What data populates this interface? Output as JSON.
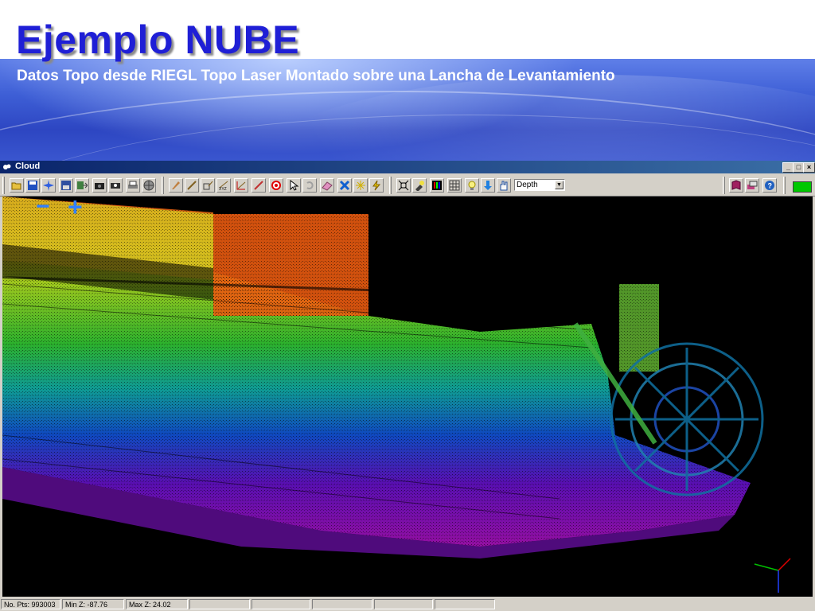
{
  "slide": {
    "title": "Ejemplo NUBE",
    "subtitle": "Datos Topo desde RIEGL Topo Laser Montado sobre una Lancha de Levantamiento"
  },
  "window": {
    "title": "Cloud",
    "minimize": "_",
    "maximize": "□",
    "close": "×"
  },
  "toolbar": {
    "color_mode": "Depth",
    "buttons": [
      "open-folder-icon",
      "save-icon",
      "burst-icon",
      "save-as-icon",
      "export-icon",
      "camera-icon",
      "snapshot-icon",
      "print-icon",
      "globe-icon",
      "cursor-edit-icon",
      "measure-line-icon",
      "measure-area-icon",
      "xyz-icon",
      "grid-draw-icon",
      "ruler-icon",
      "target-icon",
      "pointer-icon",
      "undo-icon",
      "eraser-icon",
      "close-x-icon",
      "star-burst-icon",
      "lightning-icon",
      "fit-view-icon",
      "flashlight-icon",
      "colorbar-icon",
      "grid-box-icon",
      "bulb-icon",
      "down-arrow-icon",
      "hand-icon",
      "book-icon",
      "layers-icon",
      "help-icon"
    ],
    "status_color": "#00c800"
  },
  "viewport": {
    "zoom_out": "−",
    "zoom_in": "+"
  },
  "status": {
    "points": "No. Pts: 993003",
    "min_z": "Min Z: -87.76",
    "max_z": "Max Z: 24.02"
  },
  "colors": {
    "title": "#1f1fd6",
    "banner": "#3e5fd6"
  }
}
